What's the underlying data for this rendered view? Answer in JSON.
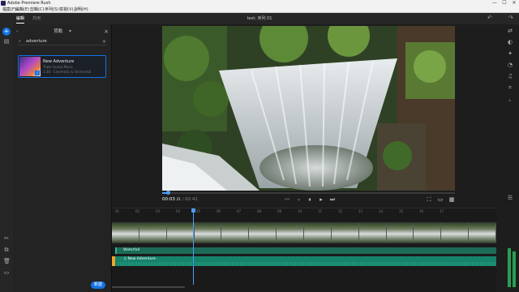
{
  "window": {
    "app_name": "Adobe Premiere Rush",
    "controls": [
      "—",
      "☐",
      "✕"
    ]
  },
  "menu": [
    "檔案(F)",
    "編輯(E)",
    "剪輯(C)",
    "序列(S)",
    "檢視(V)",
    "說明(H)"
  ],
  "header": {
    "project_title": "test: 序列 01",
    "tabs": [
      {
        "label": "編輯",
        "active": true
      },
      {
        "label": "共用",
        "active": false
      }
    ]
  },
  "panel": {
    "title": "背軌",
    "search_value": "adventure",
    "results": [
      {
        "title": "New Adventure",
        "line1": "Triple Scoop Music",
        "line2": "1:38 · Cinematic & Orchestral"
      }
    ],
    "new_button": "新建"
  },
  "player": {
    "current_time": "00:03",
    "current_frames": "21",
    "separator": "/",
    "duration": "02:41",
    "progress": 0.02
  },
  "timeline": {
    "ruler_labels": [
      "01",
      "02",
      "03",
      "04",
      "05",
      "06",
      "07",
      "08",
      "09",
      "10",
      "11",
      "12",
      "13",
      "14",
      "15",
      "16",
      "17"
    ],
    "tracks": {
      "video_frames": 14,
      "audio1_label": "Waterfall",
      "audio2_label": "New Adventure"
    }
  },
  "colors": {
    "accent": "#1473e6",
    "audio_clip": "#16826b",
    "music_marker": "#f0a526"
  }
}
